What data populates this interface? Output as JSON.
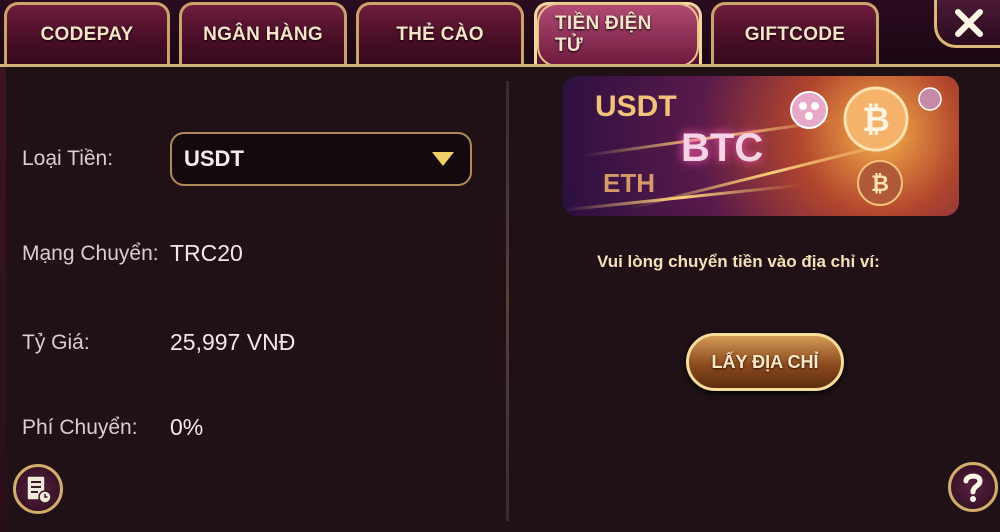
{
  "tabs": [
    {
      "label": "CODEPAY",
      "active": false
    },
    {
      "label": "NGÂN HÀNG",
      "active": false
    },
    {
      "label": "THẺ CÀO",
      "active": false
    },
    {
      "label": "TIỀN ĐIỆN TỬ",
      "active": true
    },
    {
      "label": "GIFTCODE",
      "active": false
    }
  ],
  "form": {
    "currency_label": "Loại Tiền:",
    "currency_value": "USDT",
    "network_label": "Mạng Chuyển:",
    "network_value": "TRC20",
    "rate_label": "Tỷ Giá:",
    "rate_value": "25,997 VNĐ",
    "fee_label": "Phí Chuyển:",
    "fee_value": "0%"
  },
  "banner": {
    "word_usdt": "USDT",
    "word_btc": "BTC",
    "word_eth": "ETH"
  },
  "wallet": {
    "prompt": "Vui lòng chuyển tiền vào địa chỉ ví:",
    "button_label": "LẤY ĐỊA CHỈ"
  },
  "icons": {
    "close": "close-icon",
    "history": "history-icon",
    "help": "help-icon"
  },
  "colors": {
    "gold_border": "#d4b37a",
    "tab_active": "#7e2249",
    "panel_bg": "#1f1115",
    "select_arrow": "#f0cf6a"
  }
}
